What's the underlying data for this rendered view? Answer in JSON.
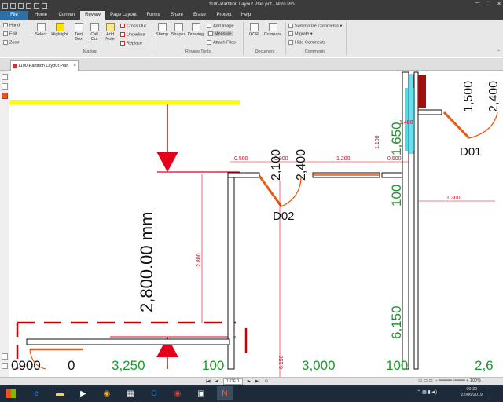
{
  "window": {
    "title": "1100-Partition Layout Plan.pdf - Nitro Pro",
    "min": "─",
    "max": "☐",
    "close": "✕"
  },
  "menu": {
    "tabs": [
      "File",
      "Home",
      "Convert",
      "Review",
      "Page Layout",
      "Forms",
      "Share",
      "Erase",
      "Protect",
      "Help"
    ],
    "active": "Review"
  },
  "ribbon": {
    "nav": {
      "hand": "Hand",
      "edit": "Edit",
      "zoom": "Zoom"
    },
    "select": "Select",
    "highlight": "Highlight",
    "text_box": [
      "Text",
      "Box"
    ],
    "call_out": [
      "Call",
      "Out"
    ],
    "add_note": [
      "Add",
      "Note"
    ],
    "cross_out": "Cross Out",
    "underline": "Underline",
    "replace": "Replace",
    "stamp": "Stamp",
    "shapes": "Shapes",
    "drawing": "Drawing",
    "add_image": "Add Image",
    "measure": "Measure",
    "attach_files": "Attach Files",
    "ocr": "OCR",
    "compare": "Compare",
    "summarize": "Summarize Comments",
    "migrate": "Migrate",
    "hide_comments": "Hide Comments",
    "groups": {
      "markup": "Markup",
      "review_tools": "Review Tools",
      "document": "Document",
      "comments": "Comments"
    }
  },
  "doc_tab": {
    "label": "1100-Partition Layout Plan"
  },
  "drawing": {
    "big_dim": "2,800.00 mm",
    "dim_2800": "2.800",
    "dim_0500a": "0.500",
    "dim_0900": "0.900",
    "dim_1200": "1.200",
    "dim_0500b": "0.500",
    "dim_1400": "1.400",
    "dim_1100": "1.100",
    "dim_1300": "1.300",
    "dim_6150_small": "6.150",
    "door_d02": "D02",
    "door_d01": "D01",
    "dim_2100": "2,100",
    "dim_2400a": "2,400",
    "dim_1500": "1,500",
    "dim_2400b": "2,400",
    "dim_1650": "1,650",
    "dim_100_mid": "100",
    "dim_6150_big": "6,150",
    "bottom_0900": "0900",
    "bottom_0": "0",
    "bottom_3250": "3,250",
    "bottom_100a": "100",
    "bottom_3000": "3,000",
    "bottom_100b": "100",
    "bottom_26": "2,6"
  },
  "status": {
    "page": "1 OF 1",
    "zoom": "100%"
  },
  "clock": {
    "time": "09:39",
    "date": "22/06/2019"
  },
  "colors": {
    "accent_red": "#e4001b",
    "dim_green": "#1a9a2a",
    "door_orange": "#e85a10",
    "highlight_yellow": "#ffff00",
    "glass_cyan": "#55d8e8",
    "dark_red": "#9c1010"
  }
}
